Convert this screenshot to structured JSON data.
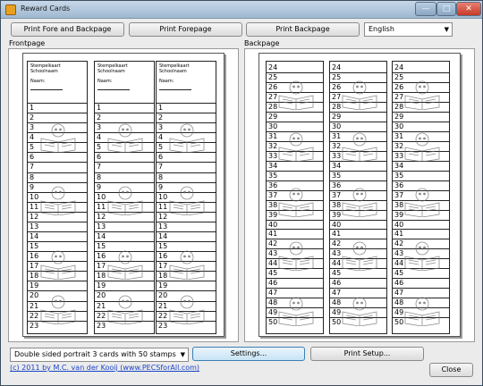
{
  "window": {
    "title": "Reward Cards",
    "controls": {
      "minimize": "—",
      "maximize": "□",
      "close": "✕"
    }
  },
  "toolbar": {
    "print_fore_and_back": "Print Fore and Backpage",
    "print_fore": "Print Forepage",
    "print_back": "Print Backpage",
    "language": "English"
  },
  "front": {
    "label": "Frontpage",
    "card_header": [
      "Stempelkaart",
      "Schoolnaam",
      "Naam:"
    ],
    "rows": [
      "1",
      "2",
      "3",
      "4",
      "5",
      "6",
      "7",
      "8",
      "9",
      "10",
      "11",
      "12",
      "13",
      "14",
      "15",
      "16",
      "17",
      "18",
      "19",
      "20",
      "21",
      "22",
      "23"
    ]
  },
  "back": {
    "label": "Backpage",
    "rows": [
      "24",
      "25",
      "26",
      "27",
      "28",
      "29",
      "30",
      "31",
      "32",
      "33",
      "34",
      "35",
      "36",
      "37",
      "38",
      "39",
      "40",
      "41",
      "42",
      "43",
      "44",
      "45",
      "46",
      "47",
      "48",
      "49",
      "50"
    ]
  },
  "bottom": {
    "layout_select": "Double sided portrait 3 cards with 50 stamps",
    "settings": "Settings...",
    "print_setup": "Print Setup...",
    "copyright": "(c) 2011 by M.C. van der Kooij (www.PECSforAll.com)",
    "close": "Close"
  },
  "icons": {
    "app": "reward-card-icon",
    "watermark": "child-reading-book-icon",
    "dropdown": "chevron-down-icon"
  }
}
